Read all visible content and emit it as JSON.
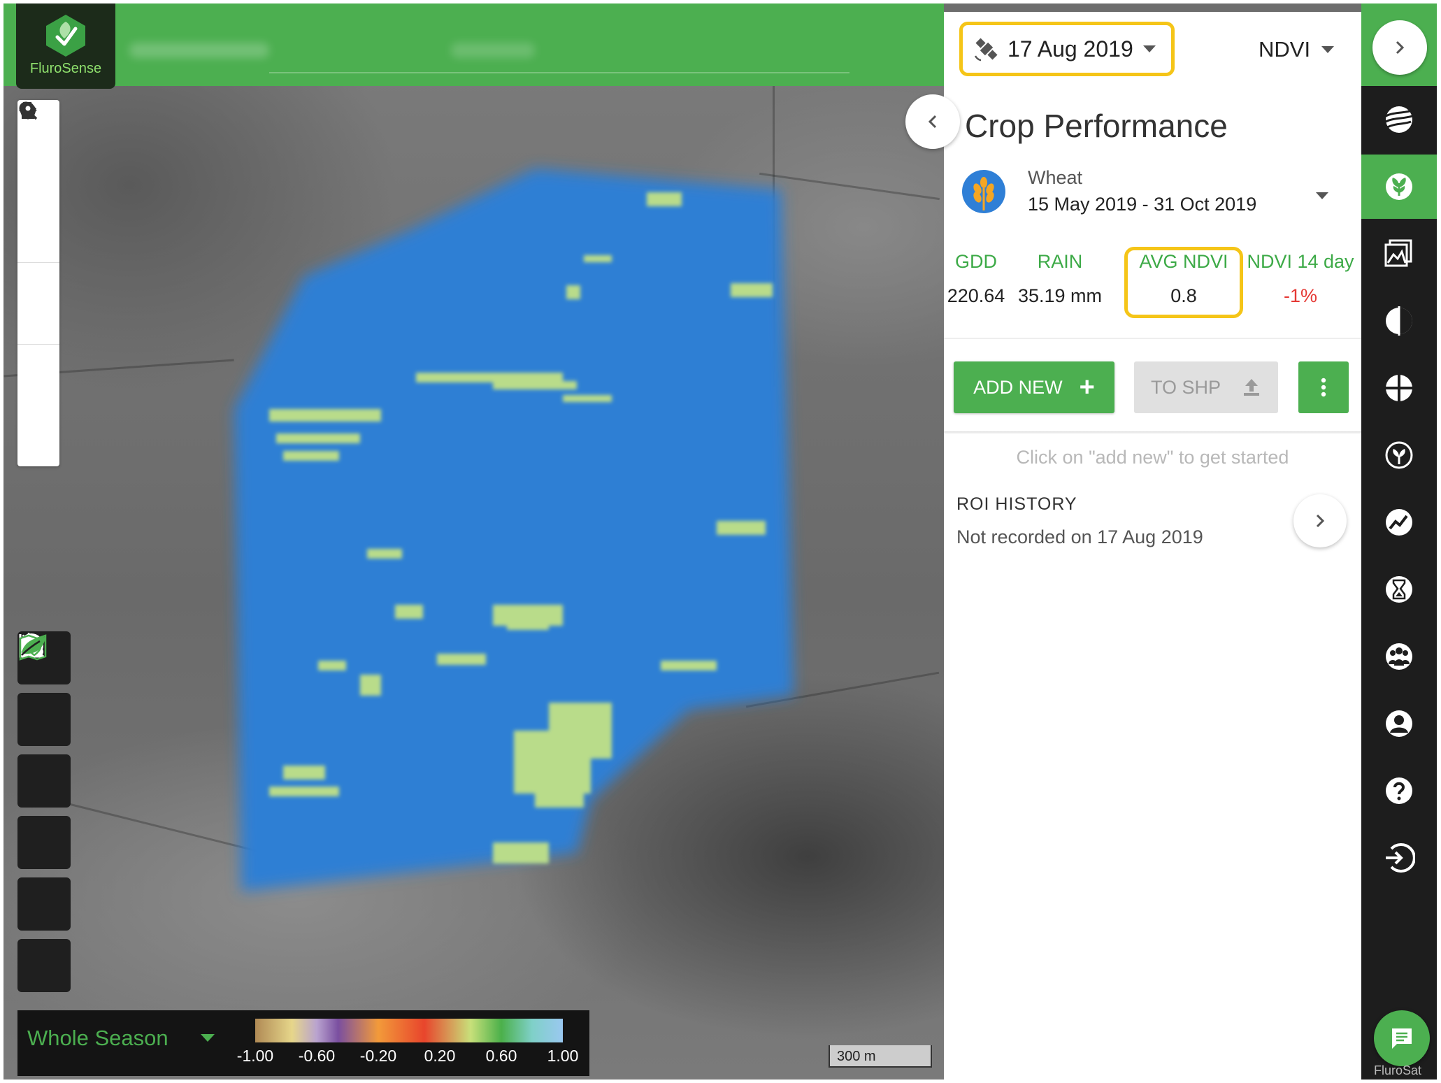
{
  "app": {
    "logo_text": "FluroSense"
  },
  "map": {
    "legend": {
      "period_label": "Whole Season",
      "ticks": [
        "-1.00",
        "-0.60",
        "-0.20",
        "0.20",
        "0.60",
        "1.00"
      ]
    },
    "scale_label": "300 m",
    "left_tools": [
      "search-icon",
      "pin-icon",
      "home-icon",
      "ruler-icon",
      "zoom-in-icon",
      "zoom-out-icon",
      "polygon-icon",
      "circle-icon",
      "marker-icon"
    ],
    "left_dark_tools": [
      "info-icon",
      "weather-icon",
      "alert-icon",
      "chart-icon",
      "map-layers-icon",
      "leaf-icon"
    ]
  },
  "panel": {
    "date": "17 Aug 2019",
    "index": "NDVI",
    "title": "Crop Performance",
    "crop": {
      "name": "Wheat",
      "dates": "15 May 2019 - 31 Oct 2019"
    },
    "stats": {
      "gdd_label": "GDD",
      "gdd_value": "220.64",
      "rain_label": "RAIN",
      "rain_value": "35.19 mm",
      "avg_ndvi_label": "AVG NDVI",
      "avg_ndvi_value": "0.8",
      "ndvi14_label": "NDVI 14 day",
      "ndvi14_value": "-1%"
    },
    "buttons": {
      "add_new": "ADD NEW",
      "to_shp": "TO SHP"
    },
    "hint": "Click on \"add new\" to get started",
    "roi_history_label": "ROI HISTORY",
    "roi_history_status": "Not recorded on 17 Aug 2019",
    "attribution": "FluroSat"
  },
  "colors": {
    "brand_green": "#4caf50",
    "highlight_yellow": "#f5c518",
    "negative_red": "#e53935",
    "field_blue": "#2f7fd6"
  }
}
